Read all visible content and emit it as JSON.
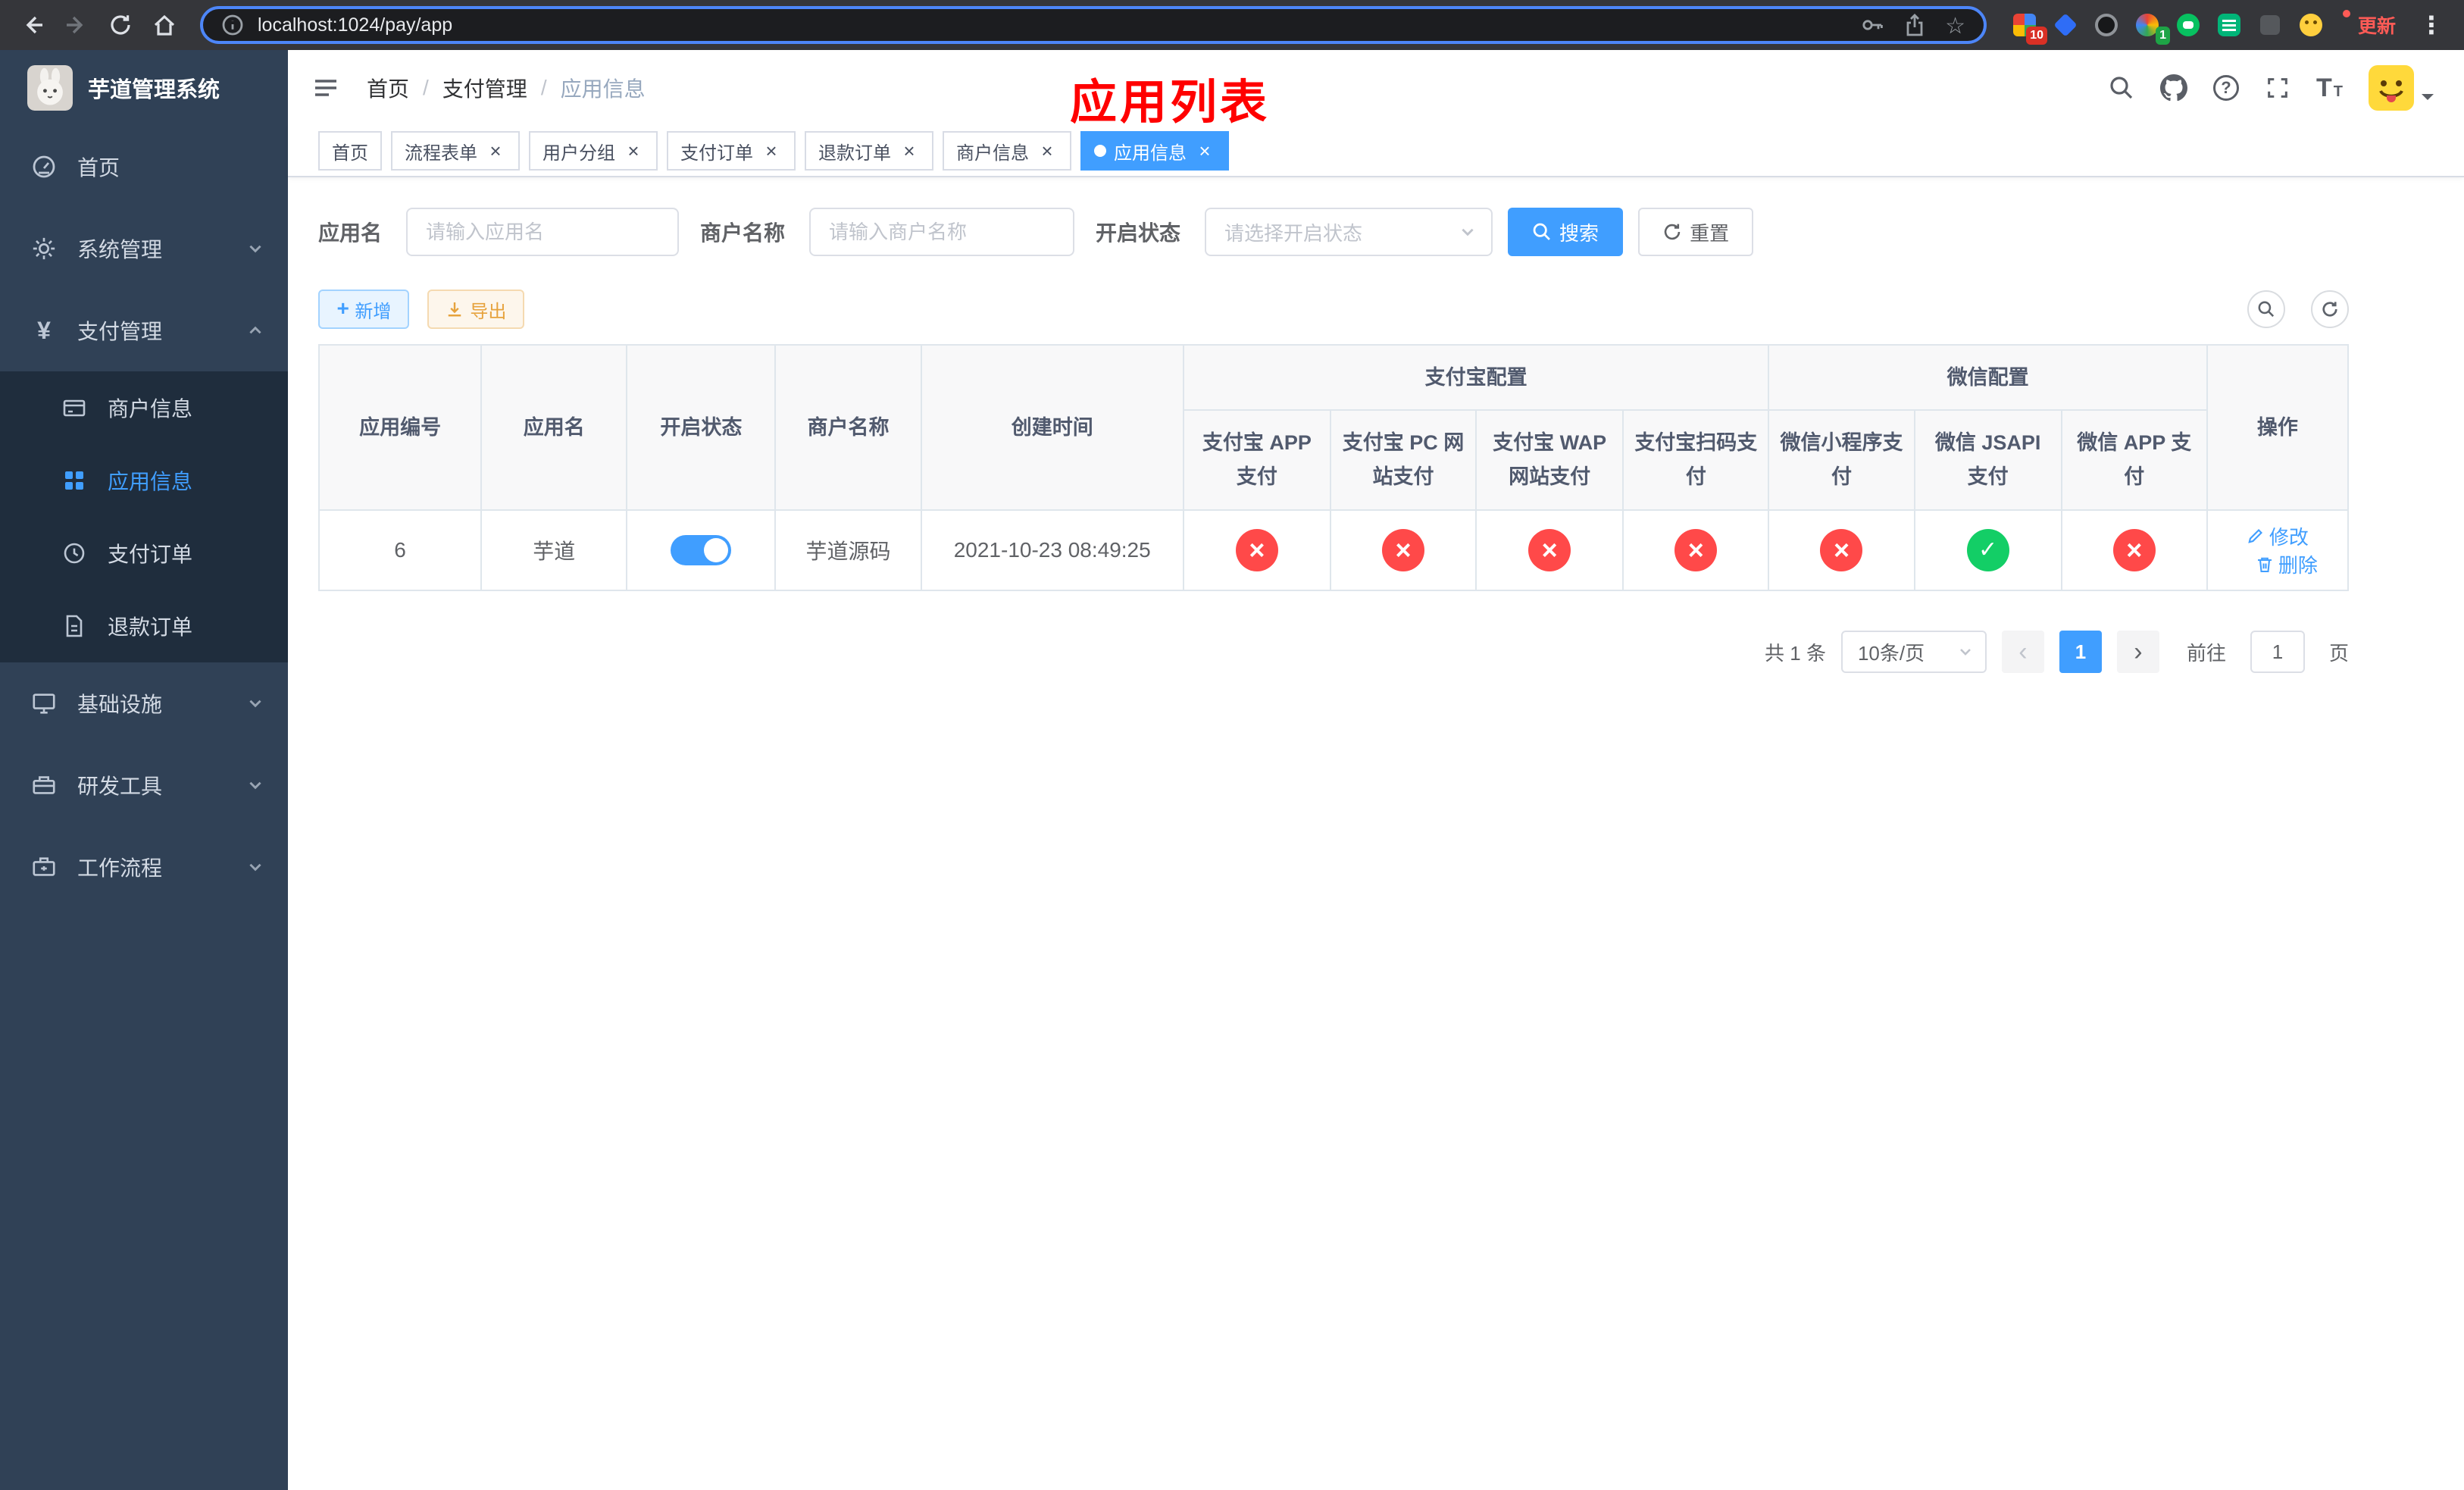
{
  "browser": {
    "url": "localhost:1024/pay/app",
    "update_button": "更新",
    "ext_badge_count": "10",
    "ext_badge_count2": "1"
  },
  "sidebar": {
    "app_title": "芋道管理系统",
    "items": [
      {
        "label": "首页"
      },
      {
        "label": "系统管理",
        "expanded": false
      },
      {
        "label": "支付管理",
        "expanded": true
      },
      {
        "label": "商户信息"
      },
      {
        "label": "应用信息",
        "active": true
      },
      {
        "label": "支付订单"
      },
      {
        "label": "退款订单"
      },
      {
        "label": "基础设施",
        "expanded": false
      },
      {
        "label": "研发工具",
        "expanded": false
      },
      {
        "label": "工作流程",
        "expanded": false
      }
    ]
  },
  "header": {
    "breadcrumb": {
      "home": "首页",
      "section": "支付管理",
      "current": "应用信息"
    },
    "annotation": "应用列表"
  },
  "tabs": [
    {
      "label": "首页",
      "closable": false,
      "active": false
    },
    {
      "label": "流程表单",
      "closable": true,
      "active": false
    },
    {
      "label": "用户分组",
      "closable": true,
      "active": false
    },
    {
      "label": "支付订单",
      "closable": true,
      "active": false
    },
    {
      "label": "退款订单",
      "closable": true,
      "active": false
    },
    {
      "label": "商户信息",
      "closable": true,
      "active": false
    },
    {
      "label": "应用信息",
      "closable": true,
      "active": true
    }
  ],
  "filters": {
    "app_name_label": "应用名",
    "app_name_placeholder": "请输入应用名",
    "merchant_label": "商户名称",
    "merchant_placeholder": "请输入商户名称",
    "status_label": "开启状态",
    "status_placeholder": "请选择开启状态",
    "search_button": "搜索",
    "reset_button": "重置"
  },
  "toolbar": {
    "add_button": "新增",
    "export_button": "导出"
  },
  "table": {
    "headers": {
      "app_id": "应用编号",
      "app_name": "应用名",
      "status": "开启状态",
      "merchant_name": "商户名称",
      "create_time": "创建时间",
      "alipay_group": "支付宝配置",
      "wechat_group": "微信配置",
      "alipay_app": "支付宝 APP 支付",
      "alipay_pc": "支付宝 PC 网站支付",
      "alipay_wap": "支付宝 WAP 网站支付",
      "alipay_scan": "支付宝扫码支付",
      "wechat_mini": "微信小程序支付",
      "wechat_jsapi": "微信 JSAPI 支付",
      "wechat_app": "微信 APP 支付",
      "actions": "操作"
    },
    "rows": [
      {
        "app_id": "6",
        "app_name": "芋道",
        "enabled": "on",
        "merchant_name": "芋道源码",
        "create_time": "2021-10-23 08:49:25",
        "alipay_app": "off",
        "alipay_pc": "off",
        "alipay_wap": "off",
        "alipay_scan": "off",
        "wechat_mini": "off",
        "wechat_jsapi": "on",
        "wechat_app": "off",
        "edit_action": "修改",
        "delete_action": "删除"
      }
    ]
  },
  "pagination": {
    "total_text": "共 1 条",
    "page_size": "10条/页",
    "page": "1",
    "goto_label": "前往",
    "goto_value": "1",
    "goto_suffix": "页"
  },
  "colors": {
    "primary": "#409eff",
    "danger": "#ff4949",
    "success": "#13ce66",
    "annotation": "#ff0000",
    "sidebar_bg": "#304156",
    "submenu_bg": "#1f2d3d"
  }
}
